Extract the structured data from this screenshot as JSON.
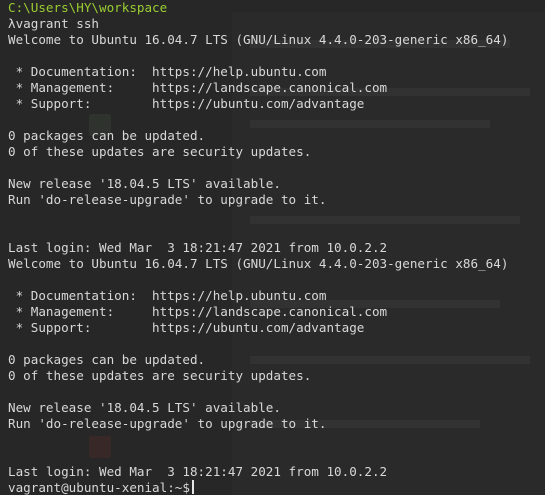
{
  "prompt_path": "C:\\Users\\HY\\workspace",
  "command": "λvagrant ssh",
  "sessions": [
    {
      "welcome": "Welcome to Ubuntu 16.04.7 LTS (GNU/Linux 4.4.0-203-generic x86_64)",
      "doc": " * Documentation:  https://help.ubuntu.com",
      "mgmt": " * Management:     https://landscape.canonical.com",
      "support": " * Support:        https://ubuntu.com/advantage",
      "pkgs": "0 packages can be updated.",
      "sec": "0 of these updates are security updates.",
      "release": "New release '18.04.5 LTS' available.",
      "upgrade": "Run 'do-release-upgrade' to upgrade to it.",
      "last_login": "Last login: Wed Mar  3 18:21:47 2021 from 10.0.2.2"
    },
    {
      "welcome": "Welcome to Ubuntu 16.04.7 LTS (GNU/Linux 4.4.0-203-generic x86_64)",
      "doc": " * Documentation:  https://help.ubuntu.com",
      "mgmt": " * Management:     https://landscape.canonical.com",
      "support": " * Support:        https://ubuntu.com/advantage",
      "pkgs": "0 packages can be updated.",
      "sec": "0 of these updates are security updates.",
      "release": "New release '18.04.5 LTS' available.",
      "upgrade": "Run 'do-release-upgrade' to upgrade to it.",
      "last_login": "Last login: Wed Mar  3 18:21:47 2021 from 10.0.2.2"
    }
  ],
  "shell_prompt": "vagrant@ubuntu-xenial:~$",
  "colors": {
    "background": "#272727",
    "text": "#d8d8d8",
    "path": "#9acd32"
  }
}
